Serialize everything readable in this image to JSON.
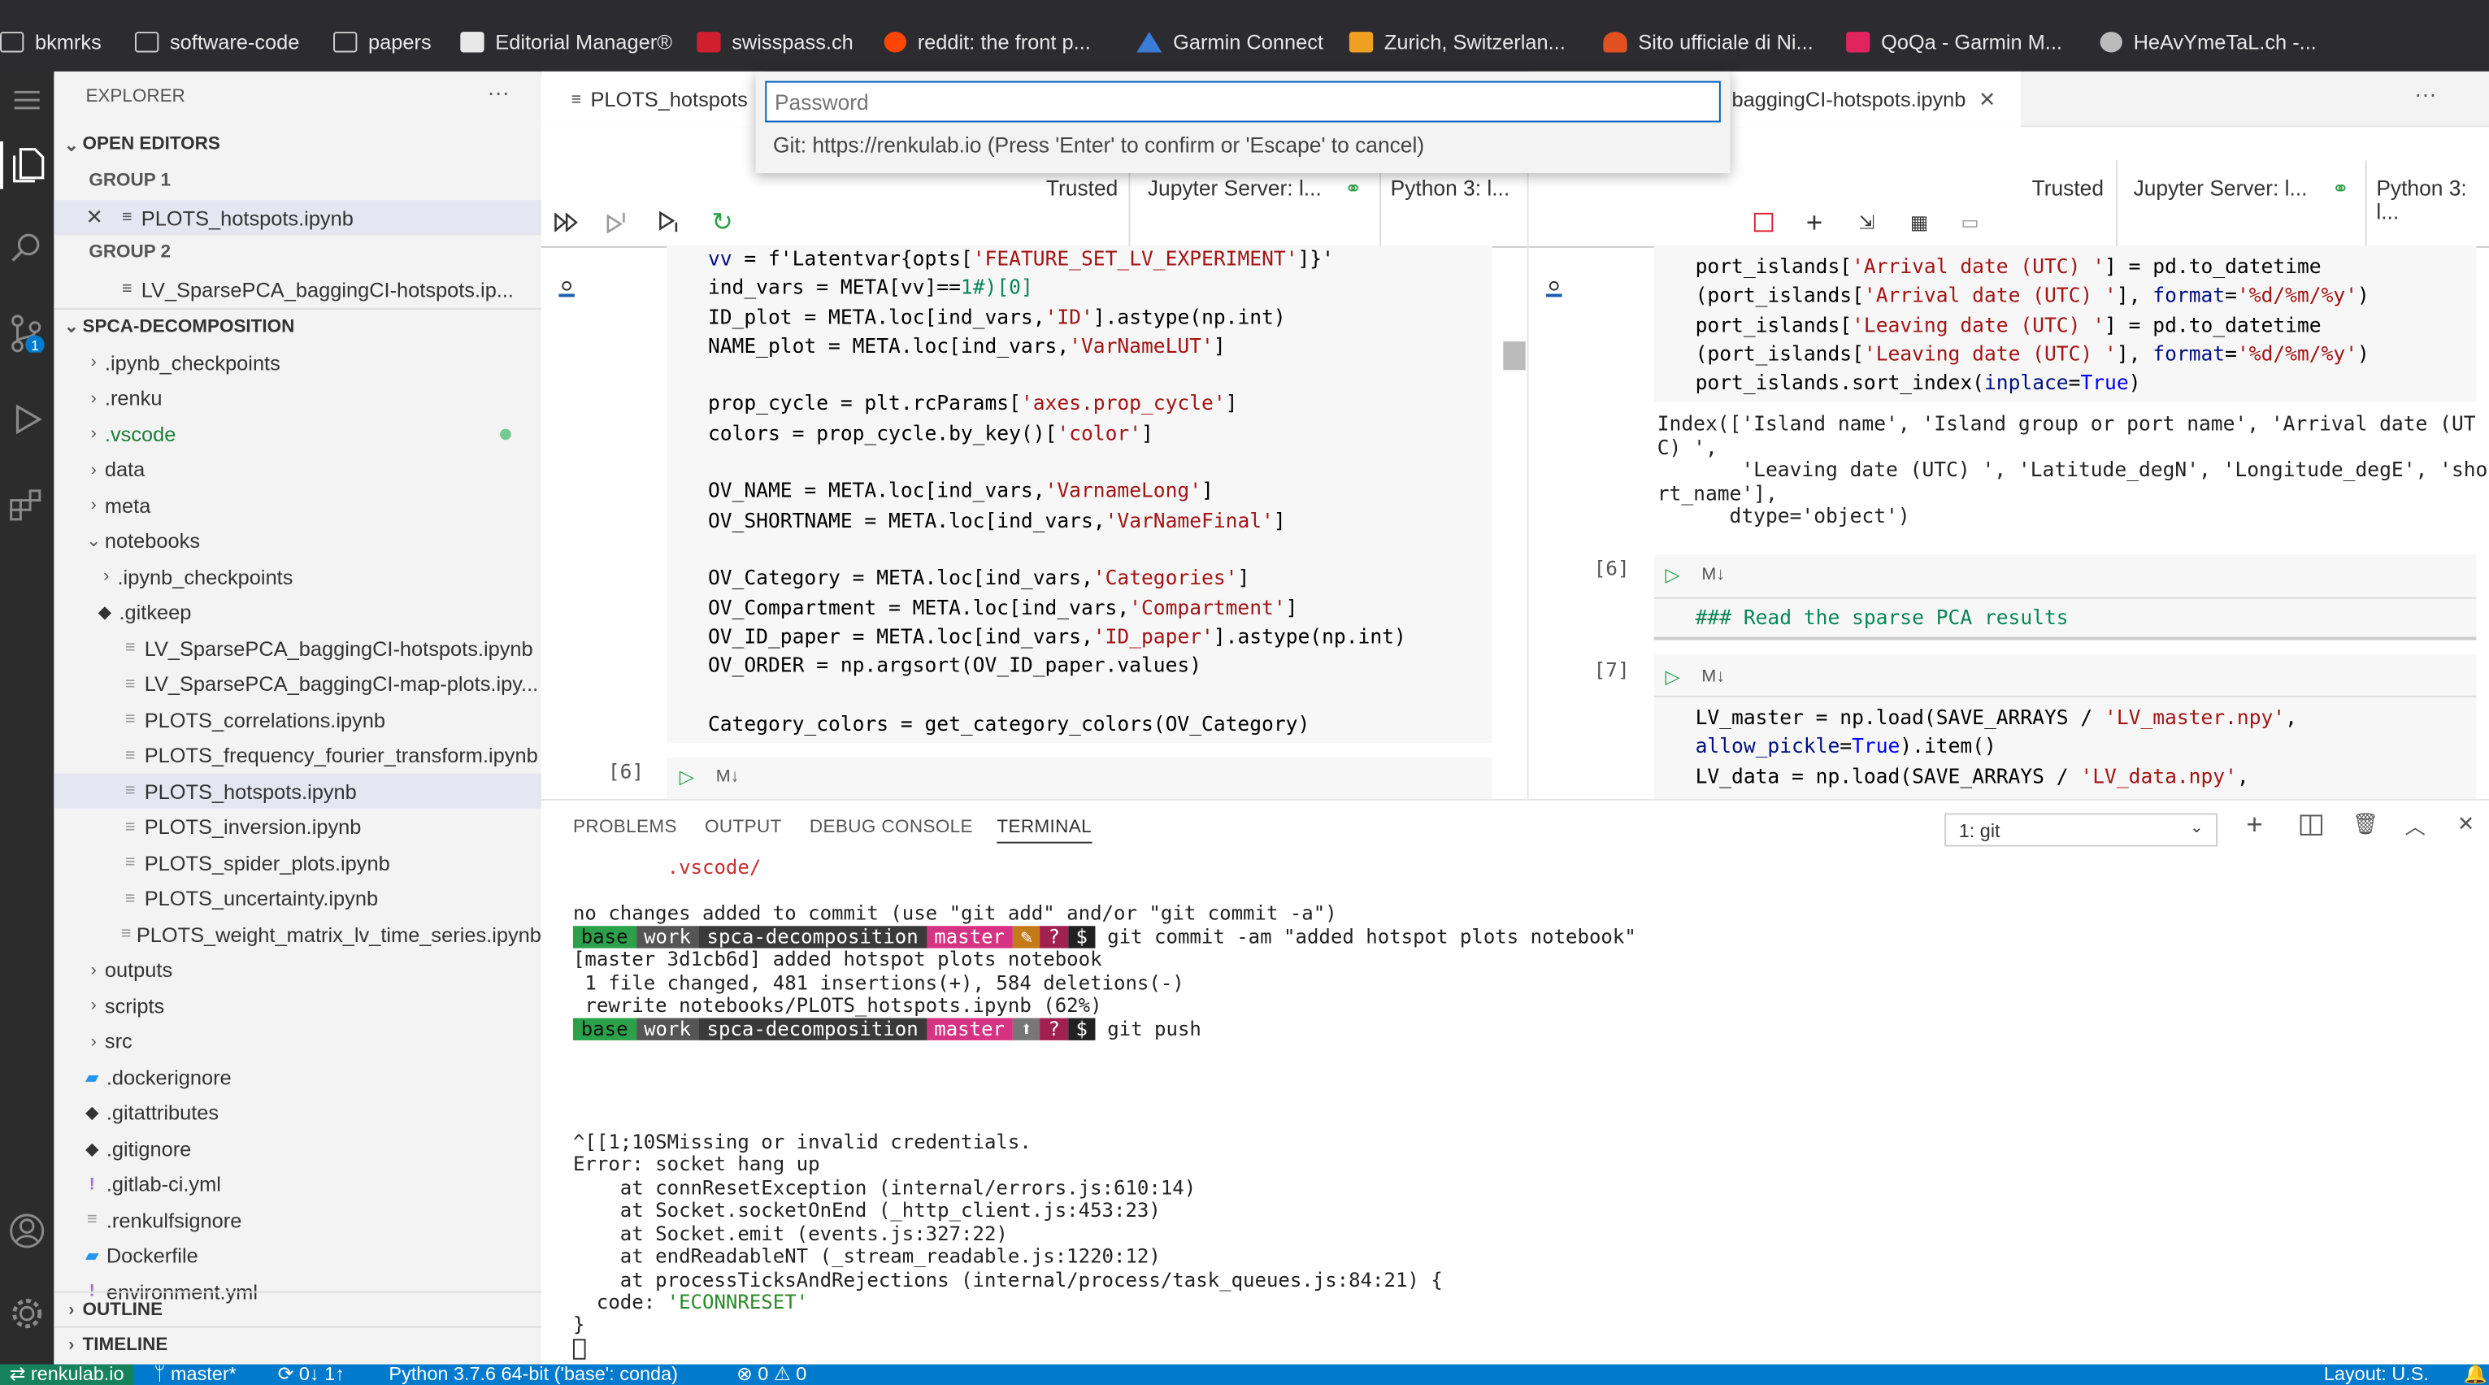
{
  "bookmarks": [
    {
      "label": "bkmrks",
      "icon": "folder-icon"
    },
    {
      "label": "software-code",
      "icon": "folder-icon"
    },
    {
      "label": "papers",
      "icon": "folder-icon"
    },
    {
      "label": "Editorial Manager®",
      "icon": "chart-icon"
    },
    {
      "label": "swisspass.ch",
      "icon": "swisspass-icon"
    },
    {
      "label": "reddit: the front p...",
      "icon": "reddit-icon"
    },
    {
      "label": "Garmin Connect",
      "icon": "garmin-icon"
    },
    {
      "label": "Zurich, Switzerlan...",
      "icon": "weather-icon"
    },
    {
      "label": "Sito ufficiale di Ni...",
      "icon": "nintendo-icon"
    },
    {
      "label": "QoQa - Garmin M...",
      "icon": "qoqa-icon"
    },
    {
      "label": "HeAvYmeTaL.ch -...",
      "icon": "globe-icon"
    }
  ],
  "explorer": {
    "title": "EXPLORER",
    "open_editors": "OPEN EDITORS",
    "group1": "GROUP 1",
    "group1_file": "PLOTS_hotspots.ipynb",
    "group2": "GROUP 2",
    "group2_file": "LV_SparsePCA_baggingCI-hotspots.ip...",
    "project": "SPCA-DECOMPOSITION",
    "tree": [
      {
        "label": ".ipynb_checkpoints",
        "type": "folder"
      },
      {
        "label": ".renku",
        "type": "folder"
      },
      {
        "label": ".vscode",
        "type": "folder"
      },
      {
        "label": "data",
        "type": "folder"
      },
      {
        "label": "meta",
        "type": "folder"
      },
      {
        "label": "notebooks",
        "type": "folder-open"
      },
      {
        "label": ".ipynb_checkpoints",
        "type": "folder"
      },
      {
        "label": ".gitkeep",
        "type": "git"
      },
      {
        "label": "LV_SparsePCA_baggingCI-hotspots.ipynb",
        "type": "file"
      },
      {
        "label": "LV_SparsePCA_baggingCI-map-plots.ipy...",
        "type": "file"
      },
      {
        "label": "PLOTS_correlations.ipynb",
        "type": "file"
      },
      {
        "label": "PLOTS_frequency_fourier_transform.ipynb",
        "type": "file"
      },
      {
        "label": "PLOTS_hotspots.ipynb",
        "type": "file"
      },
      {
        "label": "PLOTS_inversion.ipynb",
        "type": "file"
      },
      {
        "label": "PLOTS_spider_plots.ipynb",
        "type": "file"
      },
      {
        "label": "PLOTS_uncertainty.ipynb",
        "type": "file"
      },
      {
        "label": "PLOTS_weight_matrix_lv_time_series.ipynb",
        "type": "file"
      },
      {
        "label": "outputs",
        "type": "folder"
      },
      {
        "label": "scripts",
        "type": "folder"
      },
      {
        "label": "src",
        "type": "folder"
      },
      {
        "label": ".dockerignore",
        "type": "docker"
      },
      {
        "label": ".gitattributes",
        "type": "git"
      },
      {
        "label": ".gitignore",
        "type": "git"
      },
      {
        "label": ".gitlab-ci.yml",
        "type": "yml"
      },
      {
        "label": ".renkulfsignore",
        "type": "file"
      },
      {
        "label": "Dockerfile",
        "type": "docker"
      },
      {
        "label": "environment.yml",
        "type": "yml"
      }
    ],
    "outline": "OUTLINE",
    "timeline": "TIMELINE"
  },
  "editor_left": {
    "tab": "PLOTS_hotspots",
    "trusted": "Trusted",
    "server": "Jupyter Server: l...",
    "kernel": "Python 3: l...",
    "exec6": "[6]",
    "md": "M↓"
  },
  "editor_right": {
    "tab": "baggingCI-hotspots.ipynb",
    "trusted": "Trusted",
    "server": "Jupyter Server: l...",
    "kernel": "Python 3: l...",
    "exec6": "[6]",
    "exec7": "[7]",
    "md": "M↓",
    "output1": "Index(['Island name', 'Island group or port name', 'Arrival date (UT",
    "output2": "C) ',",
    "output3": "       'Leaving date (UTC) ', 'Latitude_degN', 'Longitude_degE', 'sho",
    "output4": "rt_name'],",
    "output5": "      dtype='object')",
    "markdown": "### Read the sparse PCA results"
  },
  "quick_input": {
    "placeholder": "Password",
    "message": "Git: https://renkulab.io (Press 'Enter' to confirm or 'Escape' to cancel)"
  },
  "panel": {
    "tabs": [
      "PROBLEMS",
      "OUTPUT",
      "DEBUG CONSOLE",
      "TERMINAL"
    ],
    "active_tab": "TERMINAL",
    "terminal_select": "1: git",
    "prompt": {
      "env": "base",
      "dir1": "work",
      "dir2": "spca-decomposition",
      "branch": "master",
      "dollar": "$"
    },
    "lines": {
      "vscode": "        .vscode/",
      "nochanges": "no changes added to commit (use \"git add\" and/or \"git commit -a\")",
      "cmd1": "git commit -am \"added hotspot plots notebook\"",
      "r1": "[master 3d1cb6d] added hotspot plots notebook",
      "r2": " 1 file changed, 481 insertions(+), 584 deletions(-)",
      "r3": " rewrite notebooks/PLOTS_hotspots.ipynb (62%)",
      "cmd2": "git push",
      "e1": "^[[1;10SMissing or invalid credentials.",
      "e2": "Error: socket hang up",
      "e3": "    at connResetException (internal/errors.js:610:14)",
      "e4": "    at Socket.socketOnEnd (_http_client.js:453:23)",
      "e5": "    at Socket.emit (events.js:327:22)",
      "e6": "    at endReadableNT (_stream_readable.js:1220:12)",
      "e7": "    at processTicksAndRejections (internal/process/task_queues.js:84:21) {",
      "e8a": "  code: ",
      "e8b": "'ECONNRESET'",
      "e9": "}"
    }
  },
  "status": {
    "remote": "renkulab.io",
    "branch": "master*",
    "sync": "0↓ 1↑",
    "python": "Python 3.7.6 64-bit ('base': conda)",
    "problems": "0 ⚠ 0",
    "layout": "Layout: U.S."
  },
  "colors": {
    "accent": "#007acc",
    "activity": "#2c2c2c",
    "prompt_green": "#2aa14a",
    "prompt_grey": "#4a4a4a",
    "prompt_pink": "#d63384"
  }
}
